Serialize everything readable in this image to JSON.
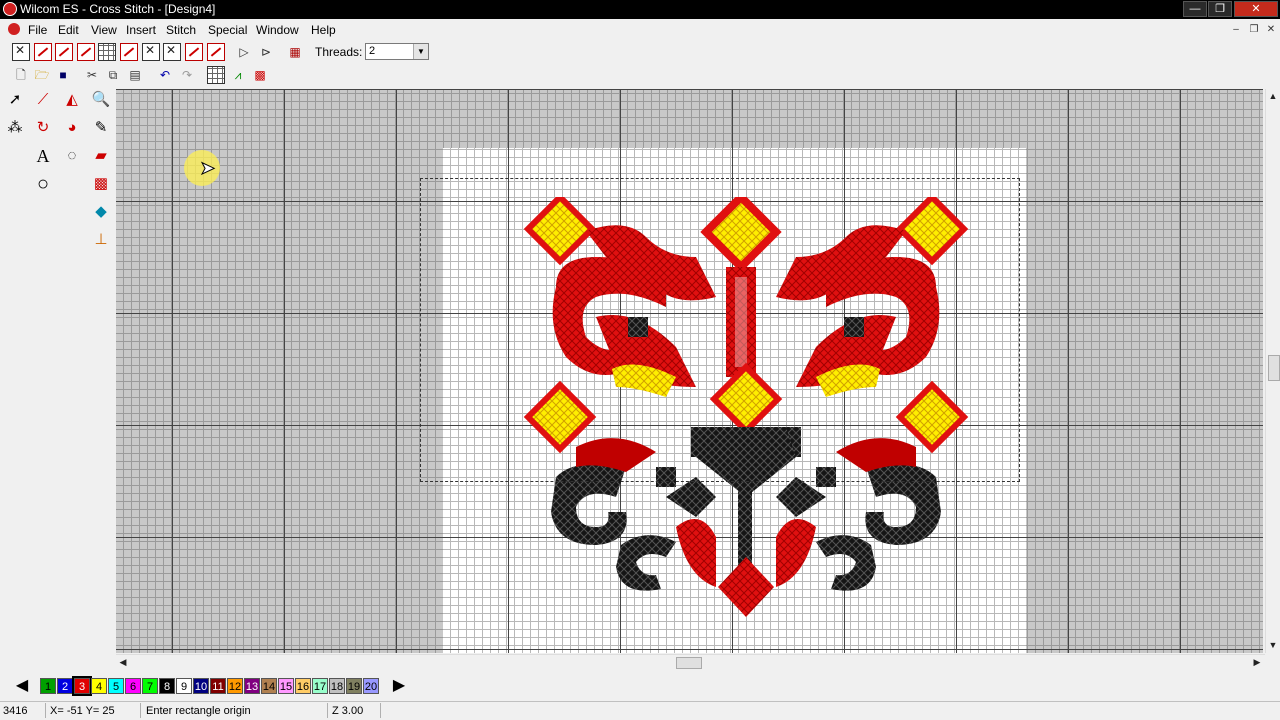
{
  "window": {
    "title": "Wilcom ES - Cross Stitch - [Design4]",
    "controls": [
      "—",
      "❐",
      "✕"
    ]
  },
  "menu": {
    "items": [
      "File",
      "Edit",
      "View",
      "Insert",
      "Stitch",
      "Special",
      "Window",
      "Help"
    ],
    "mdi_controls": [
      "–",
      "❐",
      "✕"
    ]
  },
  "toolbar": {
    "threads_label": "Threads:",
    "threads_value": "2"
  },
  "palette": {
    "prev_icon": "◀",
    "next_icon": "▶",
    "swatches": [
      {
        "label": "1",
        "color": "#00a000",
        "text": "#000"
      },
      {
        "label": "2",
        "color": "#0000e0",
        "text": "#fff"
      },
      {
        "label": "3",
        "color": "#e00000",
        "text": "#fff"
      },
      {
        "label": "4",
        "color": "#ffff00",
        "text": "#000"
      },
      {
        "label": "5",
        "color": "#00ffff",
        "text": "#000"
      },
      {
        "label": "6",
        "color": "#ff00ff",
        "text": "#000"
      },
      {
        "label": "7",
        "color": "#00ff00",
        "text": "#000"
      },
      {
        "label": "8",
        "color": "#000000",
        "text": "#fff"
      },
      {
        "label": "9",
        "color": "#ffffff",
        "text": "#000"
      },
      {
        "label": "10",
        "color": "#000080",
        "text": "#fff"
      },
      {
        "label": "11",
        "color": "#800000",
        "text": "#fff"
      },
      {
        "label": "12",
        "color": "#ff9900",
        "text": "#000"
      },
      {
        "label": "13",
        "color": "#800080",
        "text": "#fff"
      },
      {
        "label": "14",
        "color": "#b08050",
        "text": "#000"
      },
      {
        "label": "15",
        "color": "#ff99ff",
        "text": "#000"
      },
      {
        "label": "16",
        "color": "#ffcc66",
        "text": "#000"
      },
      {
        "label": "17",
        "color": "#99ffcc",
        "text": "#000"
      },
      {
        "label": "18",
        "color": "#c0c0c0",
        "text": "#000"
      },
      {
        "label": "19",
        "color": "#808060",
        "text": "#000"
      },
      {
        "label": "20",
        "color": "#9999ff",
        "text": "#000"
      }
    ]
  },
  "status": {
    "stitch_count": "3416",
    "coords": "X= -51  Y= 25",
    "prompt": "Enter rectangle origin",
    "zoom": "Z 3.00"
  },
  "colors": {
    "fabric": "#ffffff",
    "grid_bg": "#c8c8c8",
    "red": "#e01010",
    "yellow": "#ffee00",
    "black": "#111111"
  }
}
